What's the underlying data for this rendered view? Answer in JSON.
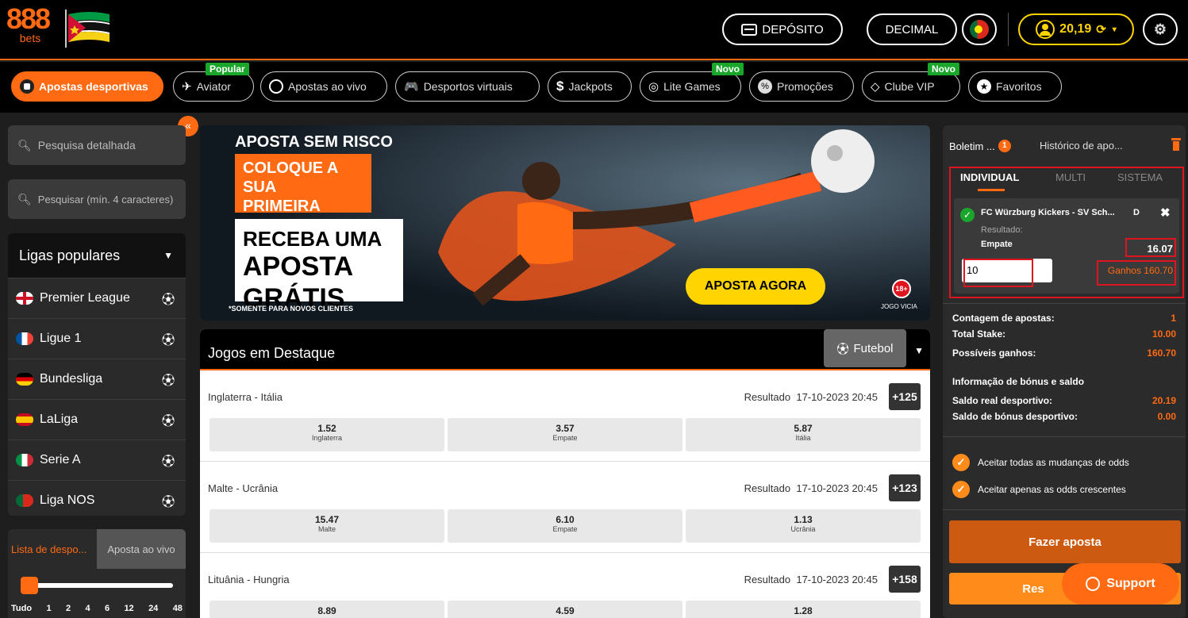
{
  "header": {
    "logo_main": "888",
    "logo_sub": "bets",
    "deposit_label": "DEPÓSITO",
    "odds_format": "DECIMAL",
    "balance": "20,19"
  },
  "nav": {
    "items": [
      {
        "label": "Apostas desportivas",
        "icon": "soccer-ball-icon"
      },
      {
        "label": "Aviator",
        "icon": "plane-icon",
        "tag": "Popular"
      },
      {
        "label": "Apostas ao vivo",
        "icon": "live-clock-icon"
      },
      {
        "label": "Desportos virtuais",
        "icon": "gamepad-icon"
      },
      {
        "label": "Jackpots",
        "icon": "dollar-icon"
      },
      {
        "label": "Lite Games",
        "icon": "target-icon",
        "tag": "Novo"
      },
      {
        "label": "Promoções",
        "icon": "percent-icon"
      },
      {
        "label": "Clube VIP",
        "icon": "diamond-icon",
        "tag": "Novo"
      },
      {
        "label": "Favoritos",
        "icon": "star-icon"
      }
    ]
  },
  "left": {
    "search_detailed": "Pesquisa detalhada",
    "search_placeholder": "Pesquisar (mín. 4 caracteres)",
    "leagues_title": "Ligas populares",
    "leagues": [
      "Premier League",
      "Ligue 1",
      "Bundesliga",
      "LaLiga",
      "Serie A",
      "Liga NOS"
    ],
    "tab_sports": "Lista de despo...",
    "tab_live": "Aposta ao vivo",
    "time_filter": [
      "Tudo",
      "1",
      "2",
      "4",
      "6",
      "12",
      "24",
      "48"
    ]
  },
  "banner": {
    "line1": "APOSTA SEM RISCO",
    "line2": "COLOQUE A SUA",
    "line3": "PRIMEIRA APOSTA",
    "line4": "RECEBA UMA",
    "line5": "APOSTA GRÁTIS",
    "footnote": "*SOMENTE PARA NOVOS CLIENTES",
    "cta": "APOSTA AGORA",
    "age": "18+",
    "age_note": "JOGO VICIA"
  },
  "featured": {
    "title": "Jogos em Destaque",
    "sport": "Futebol",
    "matches": [
      {
        "name": "Inglaterra - Itália",
        "market": "Resultado",
        "date": "17-10-2023 20:45",
        "more": "+125",
        "odds": [
          {
            "v": "1.52",
            "l": "Inglaterra"
          },
          {
            "v": "3.57",
            "l": "Empate"
          },
          {
            "v": "5.87",
            "l": "Itália"
          }
        ]
      },
      {
        "name": "Malte - Ucrânia",
        "market": "Resultado",
        "date": "17-10-2023 20:45",
        "more": "+123",
        "odds": [
          {
            "v": "15.47",
            "l": "Malte"
          },
          {
            "v": "6.10",
            "l": "Empate"
          },
          {
            "v": "1.13",
            "l": "Ucrânia"
          }
        ]
      },
      {
        "name": "Lituânia - Hungria",
        "market": "Resultado",
        "date": "17-10-2023 20:45",
        "more": "+158",
        "odds": [
          {
            "v": "8.89",
            "l": ""
          },
          {
            "v": "4.59",
            "l": ""
          },
          {
            "v": "1.28",
            "l": ""
          }
        ]
      }
    ]
  },
  "betslip": {
    "tab_slip": "Boletim ...",
    "slip_count": "1",
    "tab_history": "Histórico de apo...",
    "modes": [
      "INDIVIDUAL",
      "MULTI",
      "SISTEMA"
    ],
    "selection": {
      "event": "FC Würzburg Kickers - SV Sch...",
      "code": "D",
      "market": "Resultado:",
      "pick": "Empate",
      "odds": "16.07",
      "stake": "10",
      "winnings": "Ganhos 160.70"
    },
    "summary": [
      {
        "label": "Contagem de apostas:",
        "value": "1"
      },
      {
        "label": "Total Stake:",
        "value": "10.00"
      },
      {
        "label": "Possíveis ganhos:",
        "value": "160.70"
      }
    ],
    "bonus_title": "Informação de bónus e saldo",
    "bonus": [
      {
        "label": "Saldo real desportivo:",
        "value": "20.19"
      },
      {
        "label": "Saldo de bónus desportivo:",
        "value": "0.00"
      }
    ],
    "options": [
      "Aceitar todas as mudanças de odds",
      "Aceitar apenas as odds crescentes"
    ],
    "place_bet": "Fazer aposta",
    "reset_partial": "Res",
    "support": "Support"
  }
}
